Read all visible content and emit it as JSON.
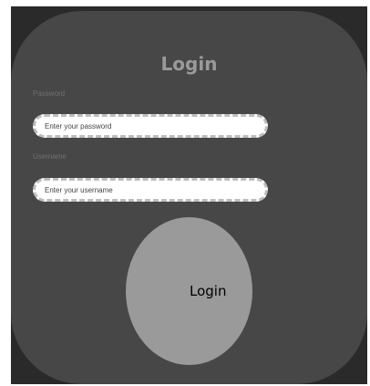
{
  "form": {
    "title": "Login",
    "password_label": "Password",
    "password_placeholder": "Enter your password",
    "password_value": "",
    "username_label": "Username",
    "username_placeholder": "Enter your username",
    "username_value": "",
    "submit_label": "Login"
  },
  "colors": {
    "background": "#2a2a2a",
    "card": "#474747",
    "button": "#9a9a9a",
    "input_border": "#bdbdbd"
  }
}
